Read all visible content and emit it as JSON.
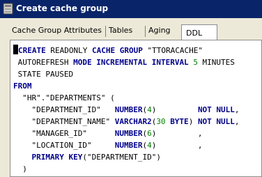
{
  "window": {
    "title": "Create cache group"
  },
  "tabs": [
    {
      "label": "Cache Group Attributes"
    },
    {
      "label": "Tables"
    },
    {
      "label": "Aging"
    },
    {
      "label": "DDL",
      "active": true
    }
  ],
  "ddl": {
    "line1": {
      "kw1": "CREATE",
      "t1": " READONLY ",
      "kw2": "CACHE GROUP",
      "t2": " \"TTORACACHE\""
    },
    "line2": {
      "t1": " AUTOREFRESH ",
      "kw1": "MODE",
      "t2": " ",
      "kw2": "INCREMENTAL",
      "t3": " ",
      "kw3": "INTERVAL",
      "t4": " ",
      "num1": "5",
      "t5": " MINUTES"
    },
    "line3": {
      "t1": " STATE PAUSED"
    },
    "line4": {
      "kw1": "FROM"
    },
    "line5": {
      "t1": "  \"HR\".\"DEPARTMENTS\" ("
    },
    "line6": {
      "t1": "    \"DEPARTMENT_ID\"   ",
      "kw1": "NUMBER",
      "t2": "(",
      "num1": "4",
      "t3": ")",
      "t4": "         ",
      "kw2": "NOT NULL",
      "t5": ","
    },
    "line7": {
      "t1": "    \"DEPARTMENT_NAME\" ",
      "kw1": "VARCHAR2",
      "t2": "(",
      "num1": "30",
      "t3": " ",
      "kw2": "BYTE",
      "t4": ") ",
      "kw3": "NOT NULL",
      "t5": ","
    },
    "line8": {
      "t1": "    \"MANAGER_ID\"      ",
      "kw1": "NUMBER",
      "t2": "(",
      "num1": "6",
      "t3": ")",
      "t4": "         ,"
    },
    "line9": {
      "t1": "    \"LOCATION_ID\"     ",
      "kw1": "NUMBER",
      "t2": "(",
      "num1": "4",
      "t3": ")",
      "t4": "         ,"
    },
    "line10": {
      "t1": "    ",
      "kw1": "PRIMARY KEY",
      "t2": "(\"DEPARTMENT_ID\")"
    },
    "line11": {
      "t1": "  )"
    }
  }
}
